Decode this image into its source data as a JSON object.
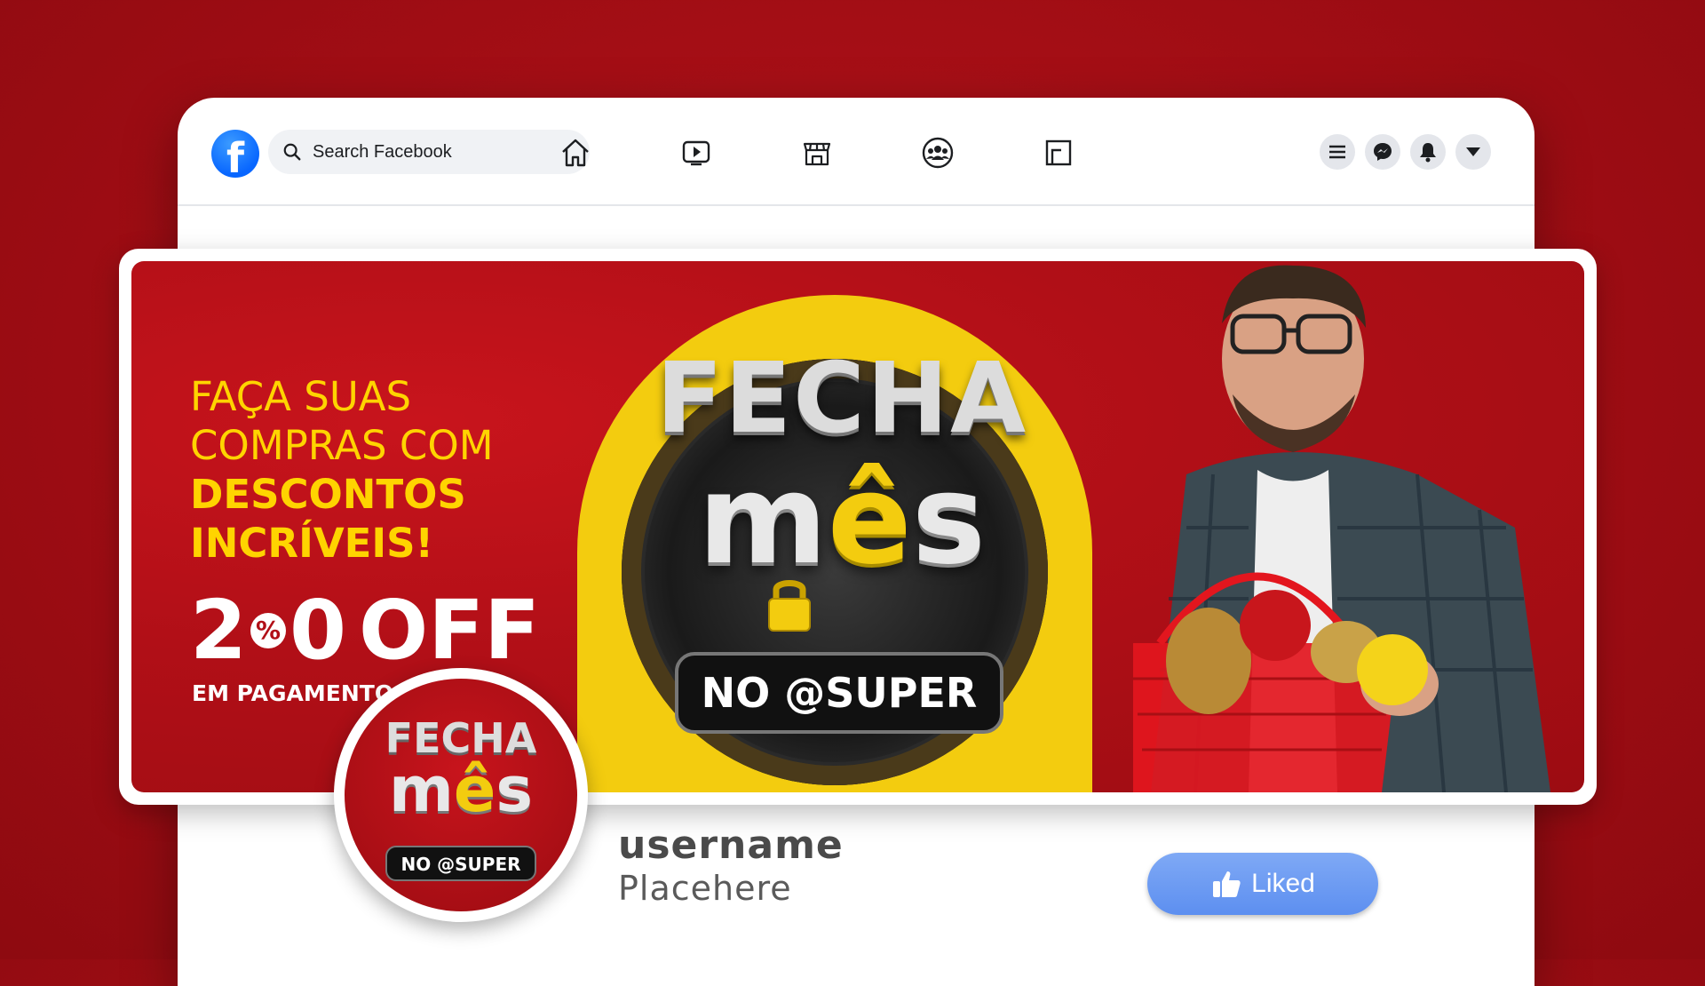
{
  "topbar": {
    "logo_letter": "f",
    "search": {
      "placeholder": "Search Facebook"
    },
    "nav_icons": [
      "home-icon",
      "video-icon",
      "marketplace-icon",
      "groups-icon",
      "gaming-icon"
    ],
    "action_icons": [
      "menu-icon",
      "messenger-icon",
      "notifications-icon",
      "account-dropdown-icon"
    ],
    "accent_color": "#0866ff"
  },
  "cover": {
    "headline_line1": "FAÇA SUAS",
    "headline_line2": "COMPRAS COM",
    "headline_line3": "DESCONTOS",
    "headline_line4": "INCRÍVEIS!",
    "discount_num_a": "2",
    "discount_pct": "%",
    "discount_num_b": "0",
    "discount_off": "OFF",
    "discount_note": "EM PAGAMENTOS V",
    "logo_title": "FECHA",
    "logo_mes_m": "m",
    "logo_mes_e": "ê",
    "logo_mes_s": "s",
    "logo_tag": "NO @SUPER",
    "colors": {
      "red": "#b10f17",
      "yellow": "#f3cc0f"
    }
  },
  "profile": {
    "avatar_title": "FECHA",
    "avatar_mes_m": "m",
    "avatar_mes_e": "ê",
    "avatar_mes_s": "s",
    "avatar_tag": "NO @SUPER",
    "username": "username",
    "subtitle": "Placehere",
    "liked_label": "Liked"
  }
}
